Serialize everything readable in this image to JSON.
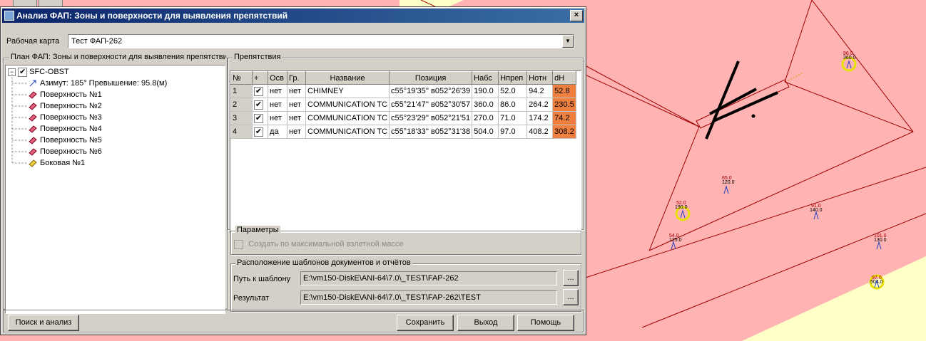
{
  "dialog": {
    "title": "Анализ ФАП: Зоны и поверхности для выявления препятствий",
    "close_glyph": "×"
  },
  "work_map": {
    "label": "Рабочая карта",
    "value": "Тест ФАП-262"
  },
  "plan": {
    "group_title": "План ФАП: Зоны и поверхности для выявления препятствий",
    "root": "SFC-OBST",
    "items": [
      {
        "label": "Азимут: 185°  Превышение: 95.8(м)",
        "icon": "azimuth-arrow-icon"
      },
      {
        "label": "Поверхность №1",
        "icon": "surface-icon"
      },
      {
        "label": "Поверхность №2",
        "icon": "surface-icon"
      },
      {
        "label": "Поверхность №3",
        "icon": "surface-icon"
      },
      {
        "label": "Поверхность №4",
        "icon": "surface-icon"
      },
      {
        "label": "Поверхность №5",
        "icon": "surface-icon"
      },
      {
        "label": "Поверхность №6",
        "icon": "surface-icon"
      },
      {
        "label": "Боковая №1",
        "icon": "side-surface-icon"
      }
    ]
  },
  "obstacles": {
    "group_title": "Препятствия",
    "columns": [
      "№",
      "+",
      "Осв",
      "Гр.",
      "Название",
      "Позиция",
      "Набс",
      "Нпреп",
      "Нотн",
      "dH"
    ],
    "rows": [
      {
        "n": "1",
        "plus": "✔",
        "osv": "нет",
        "gr": "нет",
        "name": "CHIMNEY",
        "pos": "с55°19'35'' в052°26'39",
        "habs": "190.0",
        "hprep": "52.0",
        "hotn": "94.2",
        "dh": "52.8"
      },
      {
        "n": "2",
        "plus": "✔",
        "osv": "нет",
        "gr": "нет",
        "name": "COMMUNICATION TC",
        "pos": "с55°21'47'' в052°30'57",
        "habs": "360.0",
        "hprep": "86.0",
        "hotn": "264.2",
        "dh": "230.5"
      },
      {
        "n": "3",
        "plus": "✔",
        "osv": "нет",
        "gr": "нет",
        "name": "COMMUNICATION TC",
        "pos": "с55°23'29'' в052°21'51",
        "habs": "270.0",
        "hprep": "71.0",
        "hotn": "174.2",
        "dh": "74.2"
      },
      {
        "n": "4",
        "plus": "✔",
        "osv": "да",
        "gr": "нет",
        "name": "COMMUNICATION TC",
        "pos": "с55°18'33'' в052°31'38",
        "habs": "504.0",
        "hprep": "97.0",
        "hotn": "408.2",
        "dh": "308.2"
      }
    ]
  },
  "params": {
    "group_title": "Параметры",
    "checkbox_label": "Создать по максимальной взлетной массе"
  },
  "templates": {
    "group_title": "Расположение шаблонов документов и отчётов",
    "path_label": "Путь к шаблону",
    "path_value": "E:\\vm150-DiskE\\ANI-64\\7.0\\_TEST\\FAP-262",
    "result_label": "Результат",
    "result_value": "E:\\vm150-DiskE\\ANI-64\\7.0\\_TEST\\FAP-262\\TEST",
    "browse_label": "..."
  },
  "buttons": {
    "search": "Поиск и анализ",
    "save": "Сохранить",
    "exit": "Выход",
    "help": "Помощь"
  },
  "map_labels": [
    {
      "top": "86.0",
      "bottom": "360.0"
    },
    {
      "top": "65.0",
      "bottom": "120.0"
    },
    {
      "top": "52.0",
      "bottom": "190.0"
    },
    {
      "top": "91.0",
      "bottom": "140.0"
    },
    {
      "top": "54.0",
      "bottom": "125.0"
    },
    {
      "top": "101.0",
      "bottom": "130.0"
    },
    {
      "top": "97.0",
      "bottom": "504.0"
    }
  ],
  "colors": {
    "dh_highlight": "#f08040",
    "map_zone": "#ffb3b3",
    "map_outside": "#ffffc8",
    "title_bar": "#0a246a"
  }
}
